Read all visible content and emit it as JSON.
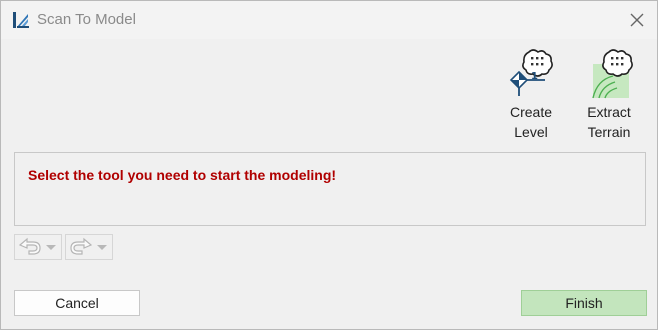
{
  "window": {
    "title": "Scan To Model",
    "icon": "app-logo-icon",
    "close_icon": "close-icon"
  },
  "toolbar": {
    "tools": [
      {
        "id": "create-level",
        "line1": "Create",
        "line2": "Level",
        "icon": "create-level-icon"
      },
      {
        "id": "extract-terrain",
        "line1": "Extract",
        "line2": "Terrain",
        "icon": "extract-terrain-icon"
      }
    ]
  },
  "message": {
    "text": "Select the tool you need to start the modeling!",
    "color": "#b00000"
  },
  "history": {
    "undo_icon": "undo-icon",
    "redo_icon": "redo-icon"
  },
  "footer": {
    "cancel_label": "Cancel",
    "finish_label": "Finish",
    "finish_color": "#c3e5bd"
  }
}
